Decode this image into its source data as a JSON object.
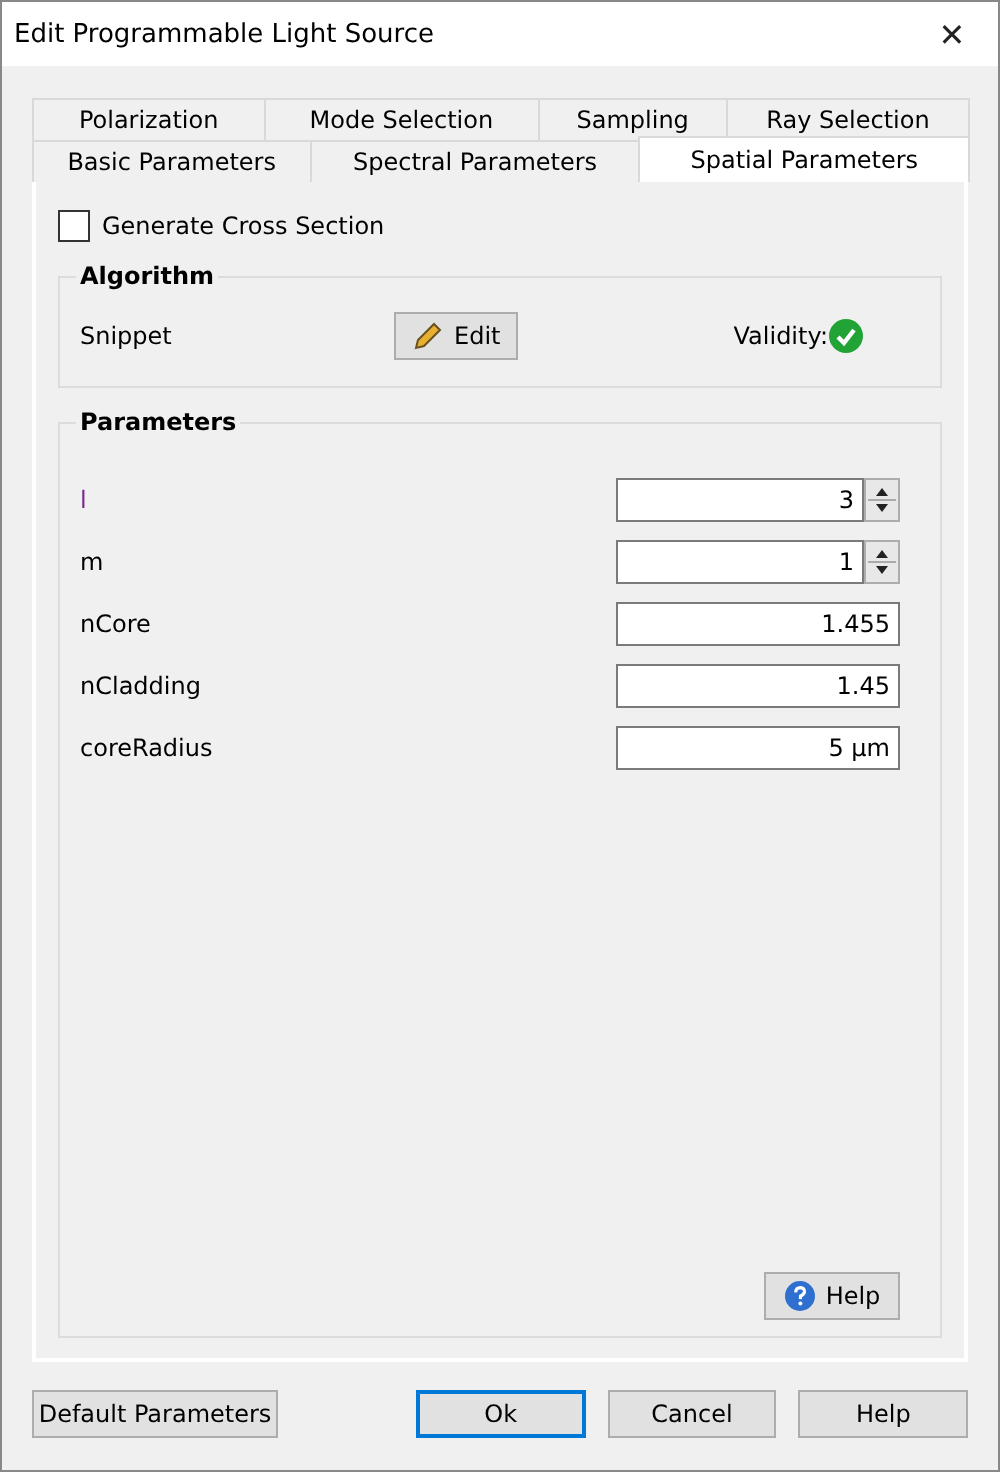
{
  "window": {
    "title": "Edit Programmable Light Source",
    "close": "✕"
  },
  "tab_rows": [
    [
      {
        "label": "Polarization",
        "selected": false
      },
      {
        "label": "Mode Selection",
        "selected": false
      },
      {
        "label": "Sampling",
        "selected": false
      },
      {
        "label": "Ray Selection",
        "selected": false
      }
    ],
    [
      {
        "label": "Basic Parameters",
        "selected": false
      },
      {
        "label": "Spectral Parameters",
        "selected": false
      },
      {
        "label": "Spatial Parameters",
        "selected": true
      }
    ]
  ],
  "cross_section": {
    "label": "Generate Cross Section",
    "checked": false
  },
  "algorithm": {
    "title": "Algorithm",
    "label": "Snippet",
    "button": "Edit",
    "validity_label": "Validity:",
    "valid": true
  },
  "parameters": {
    "title": "Parameters",
    "rows": [
      {
        "label": "l",
        "value": "3",
        "kind": "spin",
        "highlighted": true
      },
      {
        "label": "m",
        "value": "1",
        "kind": "spin",
        "highlighted": false
      },
      {
        "label": "nCore",
        "value": "1.455",
        "kind": "text",
        "highlighted": false
      },
      {
        "label": "nCladding",
        "value": "1.45",
        "kind": "text",
        "highlighted": false
      },
      {
        "label": "coreRadius",
        "value": "5 µm",
        "kind": "text",
        "highlighted": false
      }
    ],
    "help_button": "Help"
  },
  "buttons": [
    {
      "label": "Default Parameters",
      "default": false
    },
    {
      "label": "Ok",
      "default": true
    },
    {
      "label": "Cancel",
      "default": false
    },
    {
      "label": "Help",
      "default": false
    }
  ]
}
